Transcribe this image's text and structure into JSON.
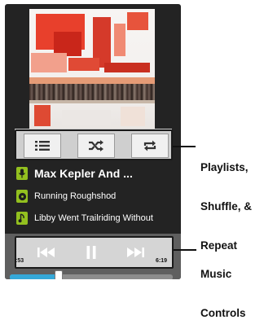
{
  "now_playing": {
    "artist_title": "Max Kepler And ...",
    "album": "Running Roughshod",
    "song": "Libby Went Trailriding Without"
  },
  "controls": {
    "playlist_icon": "list-icon",
    "shuffle_icon": "shuffle-icon",
    "repeat_icon": "repeat-icon"
  },
  "playback": {
    "elapsed": ":53",
    "duration": "6:19",
    "progress_fraction": 0.3,
    "prev_icon": "previous-track-icon",
    "pause_icon": "pause-icon",
    "next_icon": "next-track-icon"
  },
  "annotations": {
    "controls_line1": "Playlists,",
    "controls_line2": "Shuffle, &",
    "controls_line3": "Repeat",
    "playback_line1": "Music",
    "playback_line2": "Controls"
  },
  "colors": {
    "accent_green": "#93c01f",
    "progress_blue": "#35a8d8"
  }
}
